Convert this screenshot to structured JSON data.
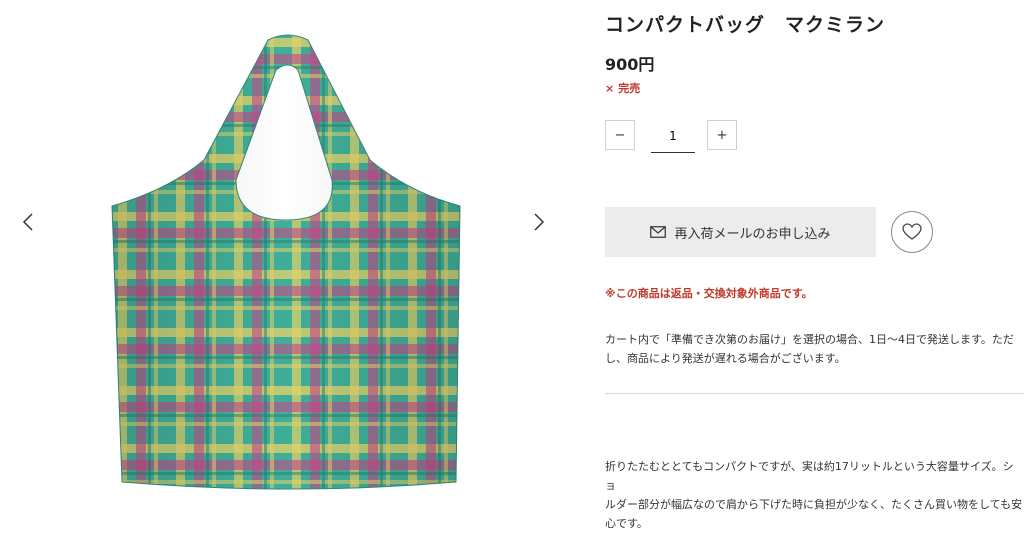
{
  "product": {
    "title": "コンパクトバッグ　マクミラン",
    "price": "900円",
    "sold_out_mark": "×",
    "sold_out_label": "完売"
  },
  "quantity": {
    "minus_label": "−",
    "value": "1",
    "plus_label": "+"
  },
  "actions": {
    "restock_label": "再入荷メールのお申し込み",
    "restock_icon": "mail-icon",
    "favorite_icon": "heart-icon"
  },
  "notice": "※この商品は返品・交換対象外商品です。",
  "shipping_lines": [
    "カート内で「準備でき次第のお届け」を選択の場合、1日〜4日で発送します。ただ",
    "し、商品により発送が遅れる場合がございます。"
  ],
  "description_lines": [
    "折りたたむととてもコンパクトですが、実は約17リットルという大容量サイズ。ショ",
    "ルダー部分が幅広なので肩から下げた時に負担が少なく、たくさん買い物をしても安",
    "心です。"
  ],
  "gallery": {
    "prev_icon": "chevron-left-icon",
    "next_icon": "chevron-right-icon"
  },
  "colors": {
    "sold_out": "#c0392b",
    "plaid_base": "#3fae98",
    "plaid_pink": "#c9468a",
    "plaid_yellow": "#e6d36a"
  }
}
